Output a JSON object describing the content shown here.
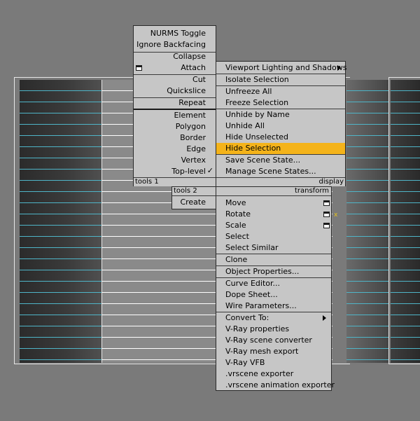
{
  "quad_left": {
    "header": "",
    "items": {
      "nurms_toggle": "NURMS Toggle",
      "ignore_backfacing": "Ignore Backfacing",
      "collapse": "Collapse",
      "attach": "Attach",
      "cut": "Cut",
      "quickslice": "Quickslice",
      "repeat": "Repeat",
      "element": "Element",
      "polygon": "Polygon",
      "border": "Border",
      "edge": "Edge",
      "vertex": "Vertex",
      "top_level": "Top-level",
      "top_level_check": "✓"
    },
    "footer_label": "tools 1"
  },
  "quad_right_top": {
    "items": {
      "viewport_lighting": "Viewport Lighting and Shadows",
      "isolate_selection": "Isolate Selection",
      "unfreeze_all": "Unfreeze All",
      "freeze_selection": "Freeze Selection",
      "unhide_by_name": "Unhide by Name",
      "unhide_all": "Unhide All",
      "hide_unselected": "Hide Unselected",
      "hide_selection": "Hide Selection",
      "save_scene_state": "Save Scene State...",
      "manage_scene_states": "Manage Scene States..."
    },
    "footer_label": "display"
  },
  "quad_tools2": {
    "header": "tools 2",
    "create": "Create"
  },
  "quad_transform": {
    "header": "transform",
    "items": {
      "move": "Move",
      "rotate": "Rotate",
      "scale": "Scale",
      "select": "Select",
      "select_similar": "Select Similar",
      "clone": "Clone",
      "object_properties": "Object Properties...",
      "curve_editor": "Curve Editor...",
      "dope_sheet": "Dope Sheet...",
      "wire_parameters": "Wire Parameters...",
      "convert_to": "Convert To:",
      "vray_properties": "V-Ray properties",
      "vray_scene_converter": "V-Ray scene converter",
      "vray_mesh_export": "V-Ray mesh export",
      "vray_vfb": "V-Ray VFB",
      "vrscene_exporter": ".vrscene exporter",
      "vrscene_anim_exporter": ".vrscene animation exporter"
    },
    "rotate_axis_marker": "x"
  },
  "colors": {
    "background": "#7a7a7a",
    "menu": "#c6c6c6",
    "highlight": "#f4b31a",
    "grid_line": "#4fb5c8"
  }
}
